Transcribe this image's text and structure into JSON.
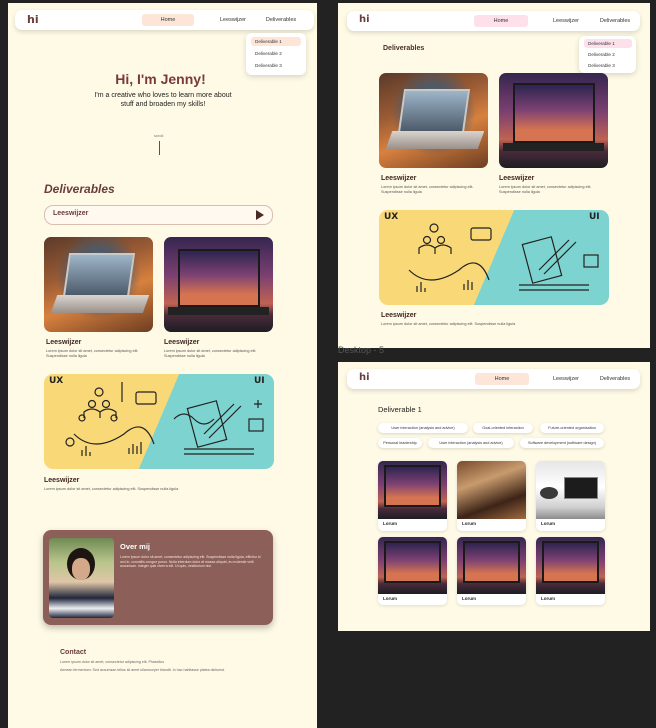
{
  "nav": {
    "logo": "hi",
    "links": [
      "Home",
      "Leeswijzer",
      "Deliverables"
    ]
  },
  "dropdown": {
    "items": [
      "Deliverable 1",
      "Deliverable 2",
      "Deliverable 3"
    ]
  },
  "hero": {
    "title": "Hi, I'm Jenny!",
    "subtitle": "I'm a creative who loves to learn more about stuff and broaden my skills!",
    "scroll": "scroll"
  },
  "deliverables": {
    "title": "Deliverables",
    "leeswijzer_button": "Leeswijzer",
    "cards": [
      {
        "title": "Leeswijzer",
        "text": "Lorem ipsum dolor sit amet, consectetur adipiscing elit. Suspendisse nulla ligula"
      },
      {
        "title": "Leeswijzer",
        "text": "Lorem ipsum dolor sit amet, consectetur adipiscing elit. Suspendisse nulla ligula"
      }
    ],
    "wide_card": {
      "title": "Leeswijzer",
      "text": "Lorem ipsum dolor sit amet, consectetur adipiscing elit. Suspendisse nulla ligula",
      "ux": "UX",
      "ui": "UI"
    }
  },
  "about": {
    "title": "Over mij",
    "text": "Lorem ipsum dolor sit amet, consectetur adipiscing elit. Suspendisse nulla ligula, efficitur id orci in, convallis congue purus. Nulla interdum dolor at massa aliquet, eu molestie velit accumsan. Integer quis viverra elit. Ut quis, vestibulum nisi."
  },
  "contact": {
    "title": "Contact",
    "line1": "Lorem ipsum dolor sit amet, consectetur adipiscing elit. Phasellus",
    "line2": "Aenean fermentum. Sed accumsan tellus sit amet ullamcorper blandit. In hac habitasse platea dictumst."
  },
  "desktop5_label": "Desktop - 5",
  "deliverable1": {
    "title": "Deliverable 1",
    "tags": [
      "User interaction (analysis and advice)",
      "Goal-oriented interaction",
      "Future-oriented organisation",
      "Personal leadership",
      "User interaction (analysis and advice)",
      "Software development (software design)"
    ],
    "items": [
      "Lorum",
      "Lorum",
      "Lorum",
      "Lorum",
      "Lorum",
      "Lorum"
    ]
  },
  "colors": {
    "cream": "#fefae6",
    "brown": "#6a3c3c",
    "mauve": "#8c6058",
    "peach": "#fde6d8",
    "yellow": "#f9d877",
    "teal": "#7dd3cf"
  }
}
